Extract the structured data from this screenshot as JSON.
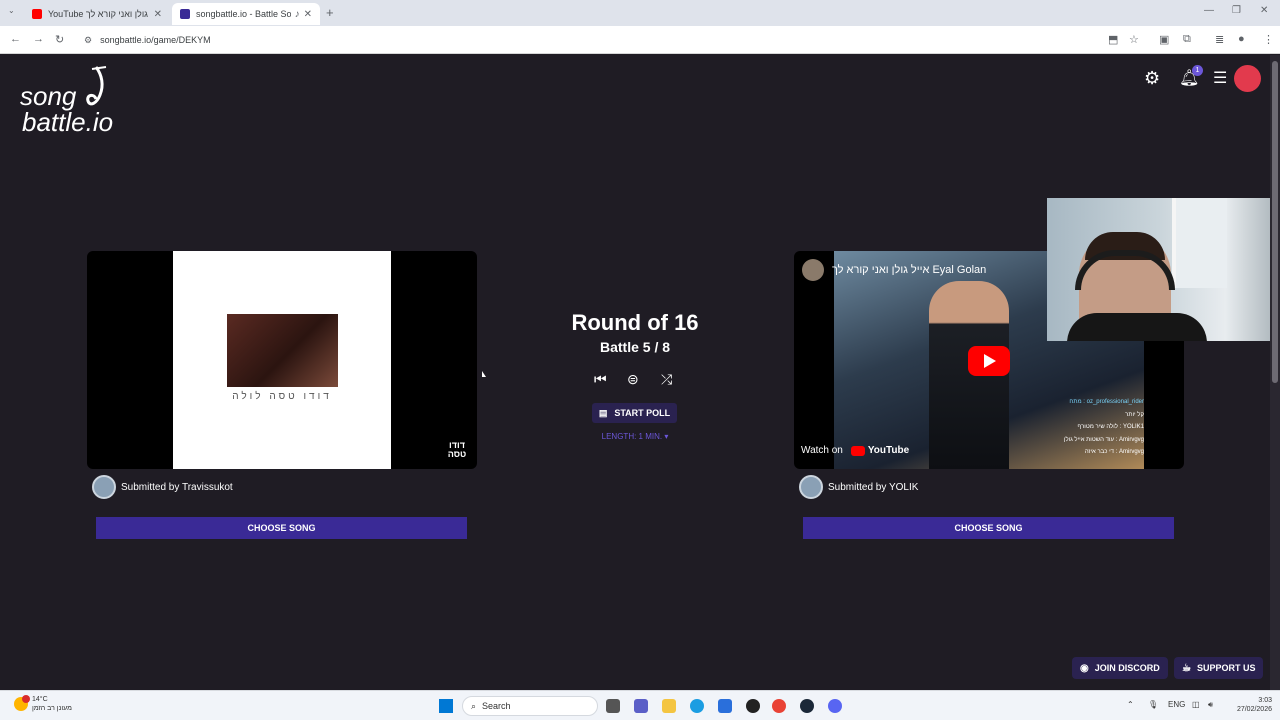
{
  "browser": {
    "tabs": [
      {
        "title": "YouTube אייל גולן ואני קורא לך",
        "color": "#ff0000"
      },
      {
        "title": "songbattle.io - Battle Song",
        "color": "#3a2a96"
      }
    ],
    "url": "songbattle.io/game/DEKYM"
  },
  "logo": {
    "line1": "song",
    "line2": "battle.io"
  },
  "header": {
    "notification_count": "1"
  },
  "battle": {
    "round": "Round of 16",
    "battle": "Battle 5 / 8",
    "poll_label": "START POLL",
    "length_label": "LENGTH: 1 MIN. ▾"
  },
  "left_song": {
    "album_text": "דודו טסה לולה",
    "corner_logo": "דודו טסה",
    "submitted_by": "Submitted by Travissukot",
    "choose_label": "CHOOSE SONG"
  },
  "right_song": {
    "video_title": "אייל גולן ואני קורא לך Eyal Golan",
    "watch_on": "Watch on",
    "youtube": "YouTube",
    "chat_lines": [
      "oz_professional_rider : מתח",
      "קל יותר",
      "YOLIK1 : לולה שיר מטורף",
      "Amirvgvg : עוד השטות אייל גולן",
      "Amirvgvg : די כבר איזה"
    ],
    "submitted_by": "Submitted by YOLIK",
    "choose_label": "CHOOSE SONG"
  },
  "footer": {
    "discord_label": "JOIN DISCORD",
    "support_label": "SUPPORT US"
  },
  "taskbar": {
    "temperature": "14°C",
    "weather_text": "מעונן רב הזמן",
    "search_label": "Search",
    "language": "ENG",
    "time": "3:03",
    "date": "27/02/2026"
  }
}
